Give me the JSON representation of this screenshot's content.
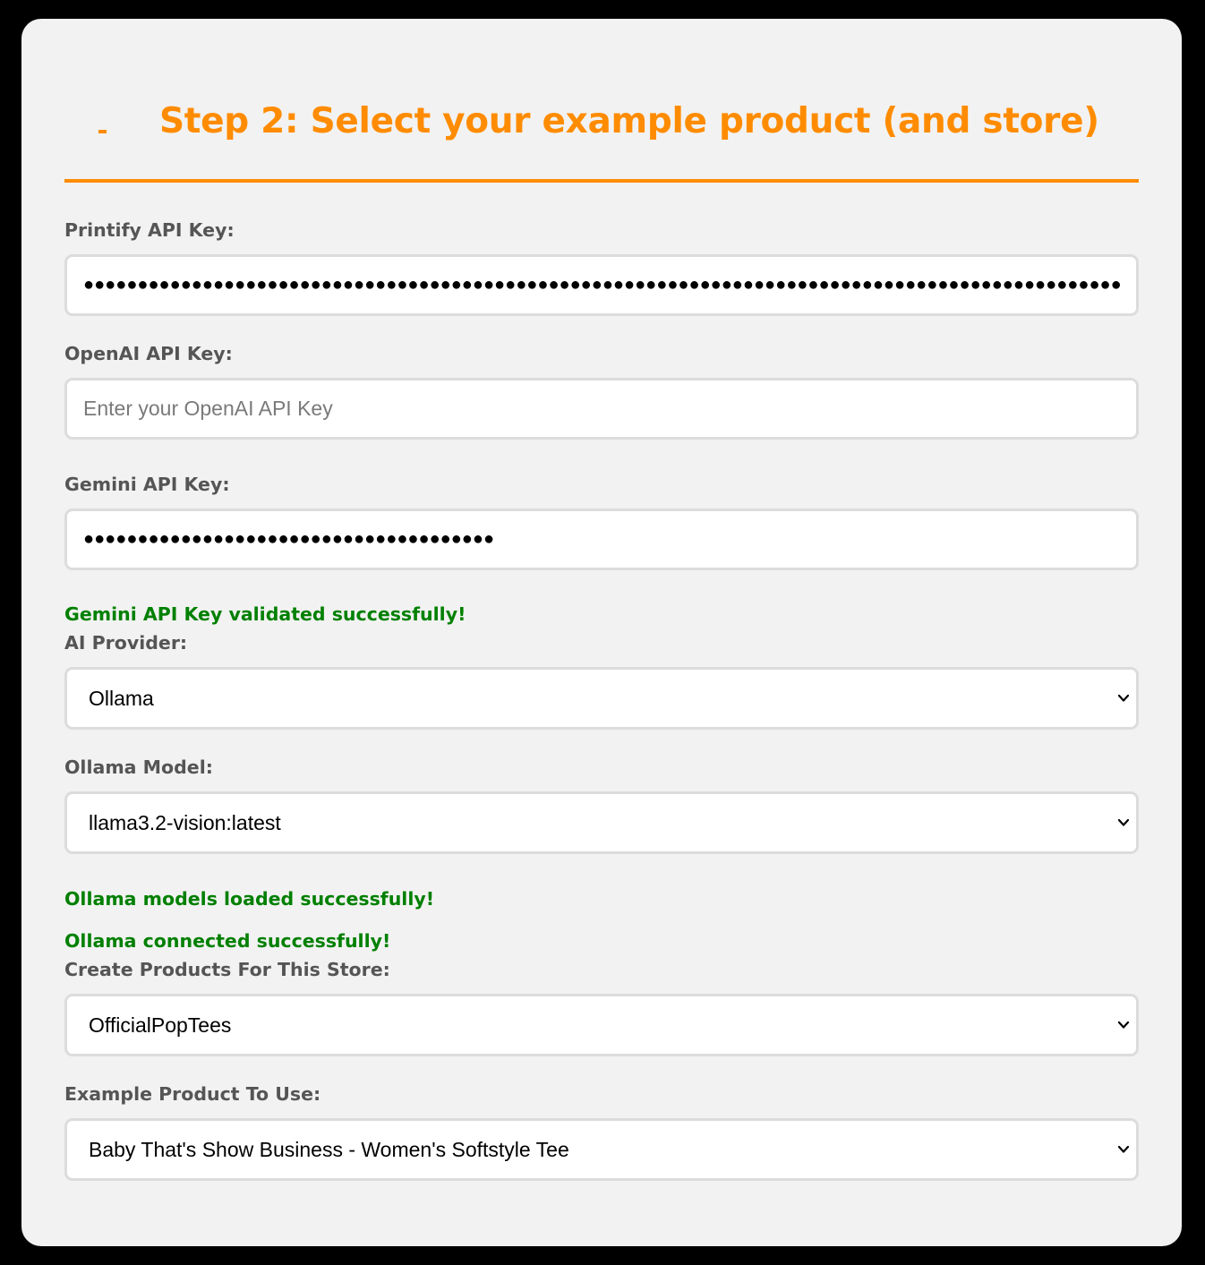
{
  "header": {
    "collapse_toggle": "-",
    "title": "Step 2: Select your example product (and store)",
    "accent_color": "#ff8c00"
  },
  "printify": {
    "label": "Printify API Key:",
    "value": "●●●●●●●●●●●●●●●●●●●●●●●●●●●●●●●●●●●●●●●●●●●●●●●●●●●●●●●●●●●●●●●●●●●●●●●●●●●●●●●●●●●●●●●●●●●●●●●●●●●●●●●●●●●●●●●●●●●●●●●●●●●"
  },
  "openai": {
    "label": "OpenAI API Key:",
    "value": "",
    "placeholder": "Enter your OpenAI API Key"
  },
  "gemini": {
    "label": "Gemini API Key:",
    "value": "●●●●●●●●●●●●●●●●●●●●●●●●●●●●●●●●●●●●●●",
    "status": "Gemini API Key validated successfully!"
  },
  "ai_provider": {
    "label": "AI Provider:",
    "selected": "Ollama"
  },
  "ollama_model": {
    "label": "Ollama Model:",
    "selected": "llama3.2-vision:latest",
    "status_models": "Ollama models loaded successfully!",
    "status_connection": "Ollama connected successfully!"
  },
  "store": {
    "label": "Create Products For This Store:",
    "selected": "OfficialPopTees"
  },
  "example_product": {
    "label": "Example Product To Use:",
    "selected": "Baby That's Show Business - Women's Softstyle Tee"
  },
  "colors": {
    "success": "#008000",
    "label": "#555555",
    "card_background": "#f2f2f2"
  }
}
